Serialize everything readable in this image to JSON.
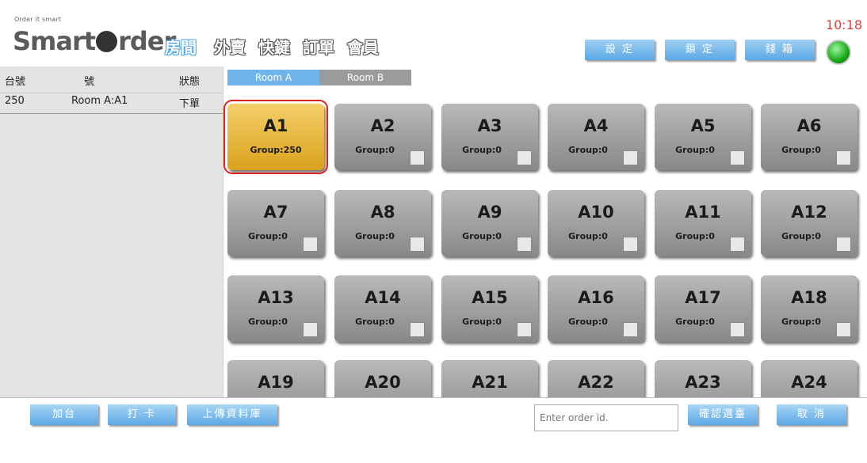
{
  "brand": {
    "tagline": "Order it smart",
    "name_left": "Smart",
    "name_right": "rder"
  },
  "nav": {
    "items": [
      {
        "label": "房間",
        "active": true
      },
      {
        "label": "外賣",
        "active": false
      },
      {
        "label": "快鍵",
        "active": false
      },
      {
        "label": "訂單",
        "active": false
      },
      {
        "label": "會員",
        "active": false
      }
    ]
  },
  "toolbar": {
    "settings_label": "設 定",
    "lock_label": "鎖 定",
    "cashbox_label": "錢 箱"
  },
  "clock": "10:18",
  "colors": {
    "accent": "#5aa8e6",
    "selected_table": "#e8b431",
    "status_online": "#17a817",
    "clock": "#e04040"
  },
  "orders_panel": {
    "columns": [
      "台號",
      "號",
      "狀態"
    ],
    "rows": [
      {
        "table": "250",
        "number": "Room A:A1",
        "status": "下單"
      }
    ]
  },
  "room_tabs": [
    {
      "label": "Room A",
      "active": true
    },
    {
      "label": "Room B",
      "active": false
    }
  ],
  "tables": [
    {
      "name": "A1",
      "group": "Group:250",
      "selected": true
    },
    {
      "name": "A2",
      "group": "Group:0"
    },
    {
      "name": "A3",
      "group": "Group:0"
    },
    {
      "name": "A4",
      "group": "Group:0"
    },
    {
      "name": "A5",
      "group": "Group:0"
    },
    {
      "name": "A6",
      "group": "Group:0"
    },
    {
      "name": "A7",
      "group": "Group:0"
    },
    {
      "name": "A8",
      "group": "Group:0"
    },
    {
      "name": "A9",
      "group": "Group:0"
    },
    {
      "name": "A10",
      "group": "Group:0"
    },
    {
      "name": "A11",
      "group": "Group:0"
    },
    {
      "name": "A12",
      "group": "Group:0"
    },
    {
      "name": "A13",
      "group": "Group:0"
    },
    {
      "name": "A14",
      "group": "Group:0"
    },
    {
      "name": "A15",
      "group": "Group:0"
    },
    {
      "name": "A16",
      "group": "Group:0"
    },
    {
      "name": "A17",
      "group": "Group:0"
    },
    {
      "name": "A18",
      "group": "Group:0"
    },
    {
      "name": "A19",
      "group": ""
    },
    {
      "name": "A20",
      "group": ""
    },
    {
      "name": "A21",
      "group": ""
    },
    {
      "name": "A22",
      "group": ""
    },
    {
      "name": "A23",
      "group": ""
    },
    {
      "name": "A24",
      "group": ""
    }
  ],
  "bottom": {
    "add_table_label": "加台",
    "punch_card_label": "打 卡",
    "upload_db_label": "上傳資料庫",
    "order_id_placeholder": "Enter order id.",
    "confirm_label": "確認選臺",
    "cancel_label": "取 消"
  }
}
